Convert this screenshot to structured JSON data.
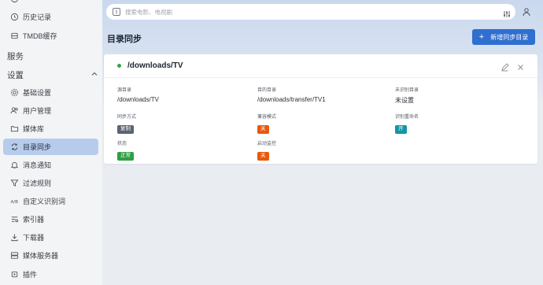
{
  "sidebar": {
    "top_items": [
      {
        "label": "历史记录",
        "icon": "history-icon"
      },
      {
        "label": "TMDB缓存",
        "icon": "database-icon"
      }
    ],
    "section_services": "服务",
    "section_settings": "设置",
    "settings_items": [
      {
        "label": "基础设置",
        "icon": "gear-icon"
      },
      {
        "label": "用户管理",
        "icon": "users-icon"
      },
      {
        "label": "媒体库",
        "icon": "folder-icon"
      },
      {
        "label": "目录同步",
        "icon": "sync-icon",
        "active": true
      },
      {
        "label": "消息通知",
        "icon": "bell-icon"
      },
      {
        "label": "过滤规则",
        "icon": "filter-icon"
      },
      {
        "label": "自定义识别词",
        "icon": "text-recognition-icon"
      },
      {
        "label": "索引器",
        "icon": "indexer-icon"
      },
      {
        "label": "下载器",
        "icon": "download-icon"
      },
      {
        "label": "媒体服务器",
        "icon": "server-icon"
      },
      {
        "label": "插件",
        "icon": "plugin-icon"
      }
    ]
  },
  "search": {
    "placeholder": "搜索电影、电视剧"
  },
  "page": {
    "title": "目录同步",
    "add_button": "新增同步目录"
  },
  "card": {
    "title": "/downloads/TV",
    "status_color": "#3aa14a",
    "fields": {
      "source_label": "源目录",
      "source_value": "/downloads/TV",
      "target_label": "目的目录",
      "target_value": "/downloads/transfer/TV1",
      "unrecognized_label": "未识别目录",
      "unrecognized_value": "未设置",
      "sync_mode_label": "同步方式",
      "sync_mode_value": "复制",
      "compat_label": "兼容模式",
      "compat_value": "关",
      "rename_label": "识别重命名",
      "rename_value": "开",
      "status_label": "状态",
      "status_value": "正常",
      "autostart_label": "启动监控",
      "autostart_value": "关"
    }
  },
  "colors": {
    "accent": "#2f6fcf",
    "active_nav": "#b7ccec",
    "orange": "#e8590c",
    "teal": "#1196a8",
    "green": "#2f9e44",
    "gray": "#5b6472"
  }
}
